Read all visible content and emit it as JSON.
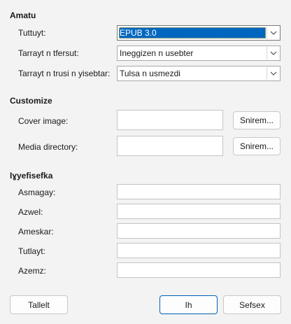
{
  "sections": {
    "general": "Amatu",
    "customize": "Customize",
    "metadata": "Iɣyefisefka"
  },
  "general": {
    "type_label": "Tuttuyt:",
    "type_value": "EPUB 3.0",
    "split_label": "Tarrayt n tfersut:",
    "split_value": "Ineggizen n usebter",
    "layout_label": "Tarrayt n trusi n yisebtar:",
    "layout_value": "Tulsa n usmezdi"
  },
  "customize": {
    "cover_label": "Cover image:",
    "cover_value": "",
    "cover_browse": "Snirem...",
    "media_label": "Media directory:",
    "media_value": "",
    "media_browse": "Snirem..."
  },
  "metadata": {
    "fields": [
      {
        "label": "Asmagay:",
        "value": ""
      },
      {
        "label": "Azwel:",
        "value": ""
      },
      {
        "label": "Ameskar:",
        "value": ""
      },
      {
        "label": "Tutlayt:",
        "value": ""
      },
      {
        "label": "Azemz:",
        "value": ""
      }
    ]
  },
  "buttons": {
    "help": "Tallelt",
    "ok": "Ih",
    "cancel": "Sefsex"
  },
  "colors": {
    "accent": "#0067c0",
    "background": "#f3f3f3"
  },
  "icons": {
    "dropdown_arrow": "chevron-down-icon"
  }
}
